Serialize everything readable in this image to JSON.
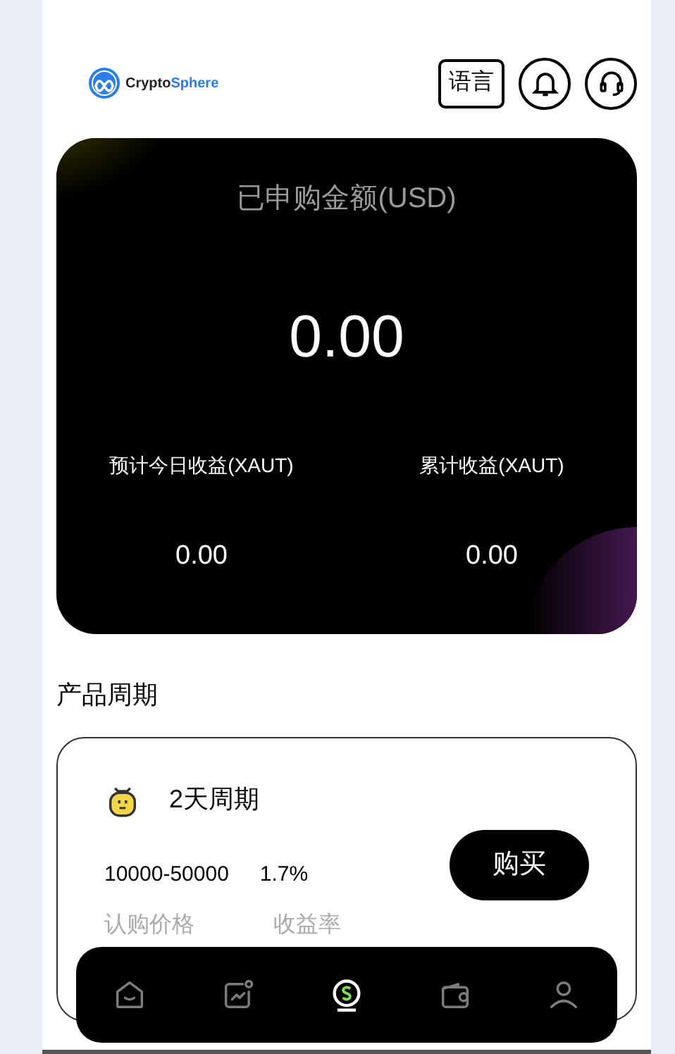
{
  "header": {
    "logo": {
      "name_prefix": "Crypto",
      "name_suffix": "Sphere"
    },
    "language_button": "语言"
  },
  "summary": {
    "title": "已申购金额(USD)",
    "amount": "0.00",
    "stats": [
      {
        "label": "预计今日收益(XAUT)",
        "value": "0.00"
      },
      {
        "label": "累计收益(XAUT)",
        "value": "0.00"
      }
    ]
  },
  "section_title": "产品周期",
  "products": [
    {
      "name": "2天周期",
      "price": "10000-50000",
      "rate": "1.7%",
      "price_label": "认购价格",
      "rate_label": "收益率",
      "buy_button": "购买"
    }
  ],
  "nav": [
    {
      "kind": "home",
      "selected": false
    },
    {
      "kind": "market",
      "selected": false
    },
    {
      "kind": "earn",
      "selected": true
    },
    {
      "kind": "wallet",
      "selected": false
    },
    {
      "kind": "profile",
      "selected": false
    }
  ]
}
